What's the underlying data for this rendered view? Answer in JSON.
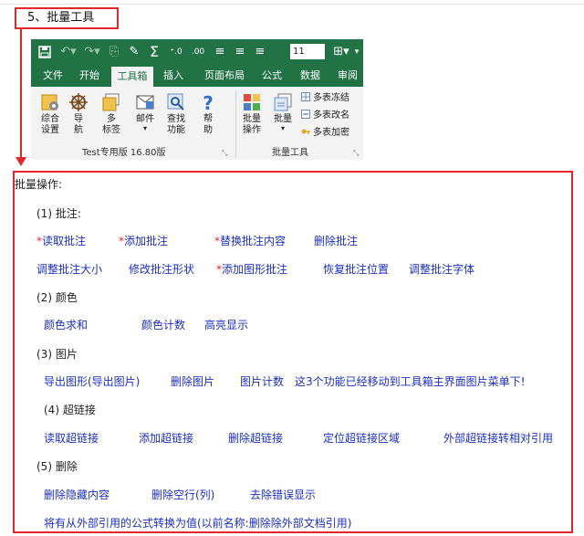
{
  "section_title": "5、批量工具",
  "ribbon": {
    "qat": {
      "save_icon": "floppy-icon",
      "font_size": "11"
    },
    "tabs": [
      "文件",
      "开始",
      "工具箱",
      "插入",
      "页面布局",
      "公式",
      "数据",
      "审阅"
    ],
    "active_tab": "工具箱",
    "tools": [
      {
        "label": "综合\n设置",
        "icon": "gear-board-icon"
      },
      {
        "label": "导\n航",
        "icon": "helm-icon"
      },
      {
        "label": "多\n标签",
        "icon": "tabs-icon"
      },
      {
        "label": "邮件",
        "icon": "mail-icon"
      },
      {
        "label": "查找\n功能",
        "icon": "find-icon"
      },
      {
        "label": "帮\n助",
        "icon": "help-icon"
      },
      {
        "label": "批量\n操作",
        "icon": "batch-op-icon"
      },
      {
        "label": "批量",
        "icon": "batch-icon"
      }
    ],
    "small_tools": [
      "多表冻结",
      "多表改名",
      "多表加密"
    ],
    "group1_label": "Test专用版 16.80版",
    "group2_label": "批量工具"
  },
  "content": {
    "title": "批量操作:",
    "s1": {
      "title": "(1)  批注:",
      "items": [
        "读取批注",
        "添加批注",
        "替换批注内容",
        "删除批注"
      ],
      "items2": [
        "调整批注大小",
        "修改批注形状",
        "添加图形批注",
        "恢复批注位置",
        "调整批注字体"
      ]
    },
    "s2": {
      "title": "(2)  颜色",
      "items": [
        "颜色求和",
        "颜色计数",
        "高亮显示"
      ]
    },
    "s3": {
      "title": "(3)  图片",
      "items": [
        "导出图形(导出图片)",
        "删除图片",
        "图片计数",
        "这3个功能已经移动到工具箱主界面图片菜单下!"
      ]
    },
    "s4": {
      "title": "(4)  超链接",
      "items": [
        "读取超链接",
        "添加超链接",
        "删除超链接",
        "定位超链接区域",
        "外部超链接转相对引用"
      ]
    },
    "s5": {
      "title": "(5)  删除",
      "items": [
        "删除隐藏内容",
        "删除空行(列)",
        "去除错误显示"
      ],
      "items2": [
        "将有从外部引用的公式转换为值(以前名称:删除除外部文档引用)"
      ]
    },
    "star": "*"
  },
  "colors": {
    "accent_red": "#e2262a",
    "excel_green": "#217346",
    "link_blue": "#1d2fc2"
  }
}
